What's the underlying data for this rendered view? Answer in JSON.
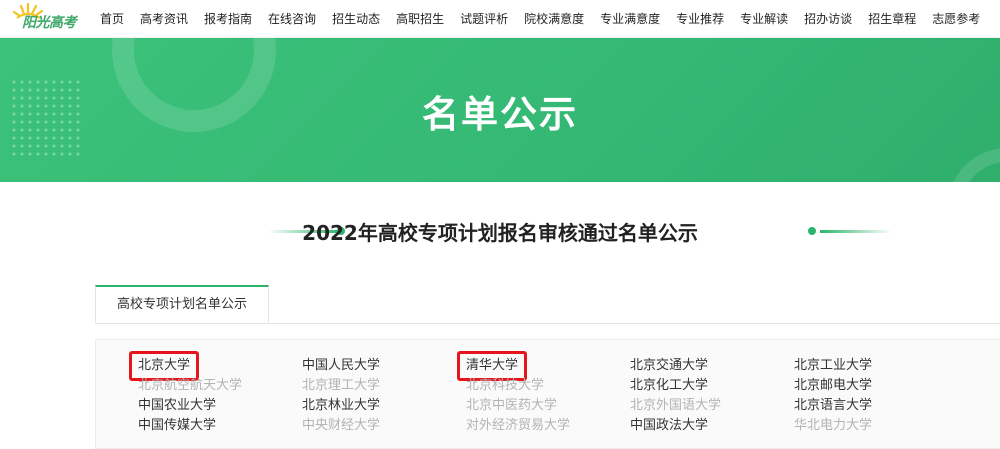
{
  "logo": {
    "text": "阳光高考"
  },
  "nav": [
    "首页",
    "高考资讯",
    "报考指南",
    "在线咨询",
    "招生动态",
    "高职招生",
    "试题评析",
    "院校满意度",
    "专业满意度",
    "专业推荐",
    "专业解读",
    "招办访谈",
    "招生章程",
    "志愿参考"
  ],
  "banner": {
    "title": "名单公示"
  },
  "section": {
    "title": "2022年高校专项计划报名审核通过名单公示"
  },
  "tabs": [
    {
      "label": "高校专项计划名单公示",
      "active": true
    }
  ],
  "universities": [
    [
      {
        "name": "北京大学",
        "highlighted": true,
        "status": "active"
      },
      {
        "name": "中国人民大学",
        "highlighted": false,
        "status": "active"
      },
      {
        "name": "清华大学",
        "highlighted": true,
        "status": "active"
      },
      {
        "name": "北京交通大学",
        "highlighted": false,
        "status": "active"
      },
      {
        "name": "北京工业大学",
        "highlighted": false,
        "status": "active"
      }
    ],
    [
      {
        "name": "北京航空航天大学",
        "highlighted": false,
        "status": "inactive"
      },
      {
        "name": "北京理工大学",
        "highlighted": false,
        "status": "inactive"
      },
      {
        "name": "北京科技大学",
        "highlighted": false,
        "status": "inactive"
      },
      {
        "name": "北京化工大学",
        "highlighted": false,
        "status": "active"
      },
      {
        "name": "北京邮电大学",
        "highlighted": false,
        "status": "active"
      }
    ],
    [
      {
        "name": "中国农业大学",
        "highlighted": false,
        "status": "active"
      },
      {
        "name": "北京林业大学",
        "highlighted": false,
        "status": "active"
      },
      {
        "name": "北京中医药大学",
        "highlighted": false,
        "status": "inactive"
      },
      {
        "name": "北京外国语大学",
        "highlighted": false,
        "status": "inactive"
      },
      {
        "name": "北京语言大学",
        "highlighted": false,
        "status": "active"
      }
    ],
    [
      {
        "name": "中国传媒大学",
        "highlighted": false,
        "status": "active"
      },
      {
        "name": "中央财经大学",
        "highlighted": false,
        "status": "inactive"
      },
      {
        "name": "对外经济贸易大学",
        "highlighted": false,
        "status": "inactive"
      },
      {
        "name": "中国政法大学",
        "highlighted": false,
        "status": "active"
      },
      {
        "name": "华北电力大学",
        "highlighted": false,
        "status": "inactive"
      }
    ]
  ],
  "colors": {
    "brand": "#2bb56b",
    "highlight": "#e8141b",
    "inactive_text": "#b3b3b3"
  }
}
